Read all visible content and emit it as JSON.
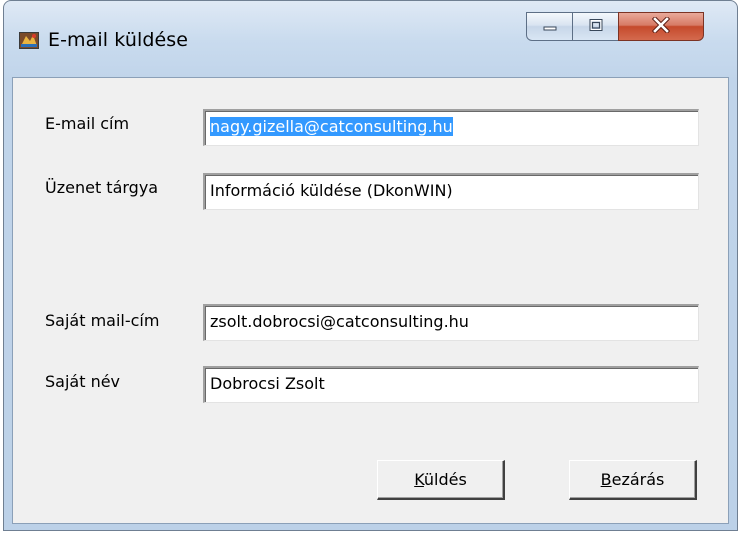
{
  "window": {
    "title": "E-mail küldése"
  },
  "form": {
    "email": {
      "label": "E-mail cím",
      "value": "nagy.gizella@catconsulting.hu"
    },
    "subject": {
      "label": "Üzenet tárgya",
      "value": "Információ küldése (DkonWIN)"
    },
    "own_email": {
      "label": "Saját mail-cím",
      "value": "zsolt.dobrocsi@catconsulting.hu"
    },
    "own_name": {
      "label": "Saját név",
      "value": "Dobrocsi Zsolt"
    }
  },
  "buttons": {
    "send": {
      "accel": "K",
      "rest": "üldés"
    },
    "close": {
      "accel": "B",
      "rest": "ezárás"
    }
  },
  "colors": {
    "selection": "#3399ff",
    "client_bg": "#f0f0f0",
    "close_button": "#c54a2c"
  },
  "icons": {
    "app": "app-icon",
    "minimize": "minimize-icon",
    "maximize": "maximize-icon",
    "close": "close-icon"
  }
}
